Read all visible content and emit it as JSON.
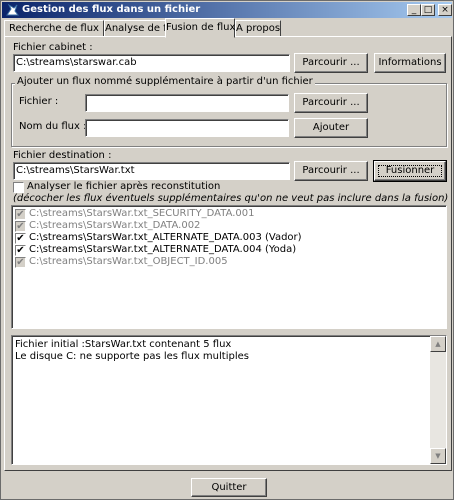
{
  "window": {
    "title": "Gestion des flux dans un fichier",
    "controls": {
      "minimize": "_",
      "maximize": "□",
      "close": "×"
    }
  },
  "tabs": [
    {
      "label": "Recherche de flux",
      "active": false
    },
    {
      "label": "Analyse de flux",
      "active": false
    },
    {
      "label": "Fusion de flux",
      "active": true
    },
    {
      "label": "A propos",
      "active": false
    }
  ],
  "cabinet": {
    "label": "Fichier cabinet :",
    "value": "C:\\streams\\starswar.cab",
    "browse_label": "Parcourir ...",
    "info_label": "Informations"
  },
  "add_stream": {
    "group_title": "Ajouter un flux nommé supplémentaire à partir d'un fichier",
    "file_label": "Fichier :",
    "file_value": "",
    "browse_label": "Parcourir ...",
    "name_label": "Nom du flux :",
    "name_value": "",
    "add_label": "Ajouter"
  },
  "destination": {
    "label": "Fichier destination :",
    "value": "C:\\streams\\StarsWar.txt",
    "browse_label": "Parcourir ...",
    "merge_label": "Fusionner",
    "analyze_label": "Analyser le fichier après reconstitution",
    "analyze_checked": false,
    "hint": "(décocher les flux éventuels supplémentaires qu'on ne veut pas inclure dans la fusion)"
  },
  "streams": [
    {
      "label": "C:\\streams\\StarsWar.txt_SECURITY_DATA.001",
      "checked": true,
      "enabled": false
    },
    {
      "label": "C:\\streams\\StarsWar.txt_DATA.002",
      "checked": true,
      "enabled": false
    },
    {
      "label": "C:\\streams\\StarsWar.txt_ALTERNATE_DATA.003 (Vador)",
      "checked": true,
      "enabled": true
    },
    {
      "label": "C:\\streams\\StarsWar.txt_ALTERNATE_DATA.004 (Yoda)",
      "checked": true,
      "enabled": true
    },
    {
      "label": "C:\\streams\\StarsWar.txt_OBJECT_ID.005",
      "checked": true,
      "enabled": false
    }
  ],
  "log": {
    "lines": [
      "Fichier initial :StarsWar.txt contenant 5 flux",
      "Le disque C: ne supporte pas les flux multiples"
    ],
    "scroll_up": "▲",
    "scroll_down": "▼"
  },
  "footer": {
    "quit_label": "Quitter"
  },
  "colors": {
    "title_start": "#0a246a",
    "title_end": "#a6caf0",
    "face": "#d4d0c8",
    "disabled_text": "#808080"
  }
}
